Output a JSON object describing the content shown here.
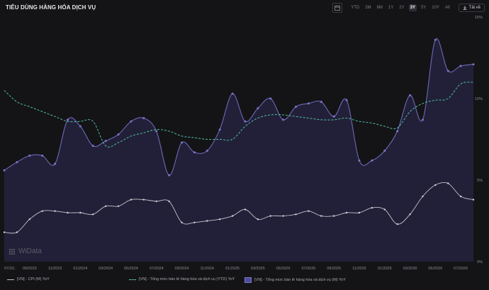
{
  "header": {
    "title": "TIÊU DÙNG HÀNG HÓA DỊCH VỤ",
    "ranges": [
      "YTD",
      "3M",
      "6M",
      "1Y",
      "2Y",
      "3Y",
      "5Y",
      "10Y",
      "All"
    ],
    "active_range": "3Y",
    "download_label": "Tải về"
  },
  "watermark": "WiData",
  "colors": {
    "cpi": "#c2c2cc",
    "ytd": "#4fbfa3",
    "monthly_line": "#6d68b8",
    "monthly_fill": "#222038"
  },
  "chart_data": {
    "type": "area",
    "x": [
      "07/2023",
      "08/2023",
      "09/2023",
      "10/2023",
      "11/2023",
      "12/2023",
      "01/2024",
      "02/2024",
      "03/2024",
      "04/2024",
      "05/2024",
      "06/2024",
      "07/2024",
      "08/2024",
      "09/2024",
      "10/2024",
      "11/2024",
      "12/2024",
      "01/2025",
      "02/2025",
      "03/2025",
      "04/2025",
      "05/2025",
      "06/2025",
      "07/2025",
      "08/2025",
      "09/2025",
      "10/2025",
      "11/2025",
      "12/2025",
      "01/2026",
      "02/2026",
      "03/2026",
      "04/2026",
      "05/2026",
      "06/2026",
      "07/2026",
      "08/2026"
    ],
    "xticks": [
      "07/20..",
      "09/2023",
      "11/2023",
      "01/2024",
      "03/2024",
      "05/2024",
      "07/2024",
      "09/2024",
      "11/2024",
      "01/2025",
      "03/2025",
      "05/2025",
      "07/2025",
      "09/2025",
      "11/2025",
      "01/2026",
      "03/2026",
      "05/2026",
      "07/2026"
    ],
    "yticks": [
      "0%",
      "5%",
      "10%",
      "15%"
    ],
    "ylim": [
      0,
      15
    ],
    "series": [
      {
        "name": "[VN] - CPI (M) YoY",
        "style": "line",
        "values": [
          1.8,
          1.8,
          2.6,
          3.1,
          3.1,
          3.0,
          3.0,
          2.9,
          3.4,
          3.4,
          3.8,
          3.8,
          3.7,
          3.7,
          2.4,
          2.4,
          2.5,
          2.6,
          2.8,
          3.2,
          2.6,
          2.8,
          2.8,
          2.9,
          3.1,
          2.8,
          2.8,
          3.0,
          3.0,
          3.3,
          3.2,
          2.3,
          2.9,
          4.0,
          4.7,
          4.8,
          4.0,
          3.8
        ]
      },
      {
        "name": "[VN] - Tổng mức bán lẻ hàng hóa và dịch vụ (YTD) YoY",
        "style": "dashed",
        "values": [
          10.5,
          9.8,
          9.5,
          9.2,
          8.9,
          8.6,
          8.6,
          8.6,
          7.1,
          7.3,
          7.7,
          7.9,
          8.1,
          8.0,
          7.7,
          7.6,
          7.5,
          7.5,
          7.5,
          8.3,
          8.8,
          9.0,
          9.0,
          8.9,
          8.8,
          8.7,
          8.7,
          8.8,
          8.6,
          8.5,
          8.3,
          8.2,
          9.2,
          9.7,
          9.9,
          10.0,
          10.9,
          11.0
        ]
      },
      {
        "name": "[VN] - Tổng mức bán lẻ hàng hóa và dịch vụ (M) YoY",
        "style": "area",
        "values": [
          5.6,
          6.1,
          6.5,
          6.5,
          6.0,
          8.7,
          8.3,
          7.1,
          7.4,
          7.8,
          8.6,
          8.8,
          8.0,
          5.3,
          7.3,
          6.7,
          6.8,
          8.1,
          10.3,
          8.6,
          9.4,
          10.0,
          8.7,
          9.5,
          9.7,
          9.8,
          8.9,
          9.9,
          6.2,
          6.2,
          6.8,
          8.0,
          10.2,
          8.7,
          13.6,
          11.7,
          12.0,
          12.1
        ]
      }
    ]
  }
}
